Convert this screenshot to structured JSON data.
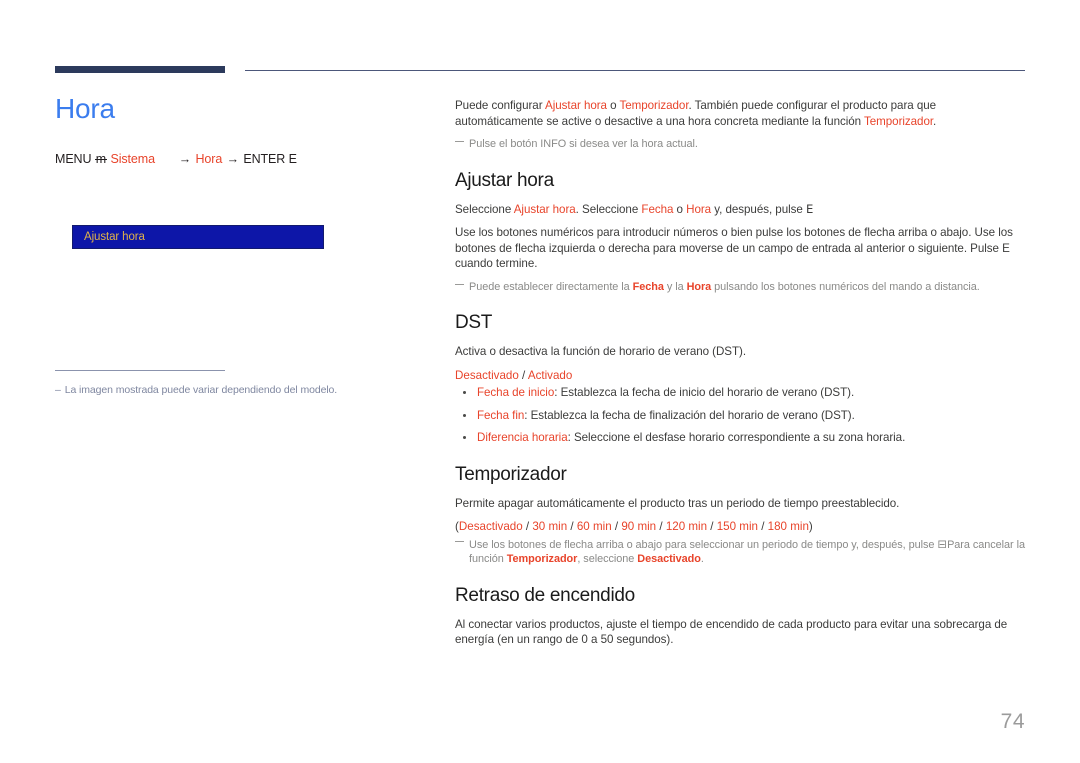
{
  "page": {
    "number": "74",
    "title": "Hora",
    "accent_color": "#e8442b",
    "title_color": "#3b7dee",
    "rule_color": "#2c3a5c"
  },
  "menu_path": {
    "menu_label": "MENU",
    "menu_glyph": "m",
    "item1": "Sistema",
    "arrow": "→",
    "item2": "Hora",
    "enter_label": "ENTER",
    "enter_glyph": "E"
  },
  "menu_image": {
    "label": "Ajustar hora",
    "fill_color": "#0d16a8",
    "border_color": "#121a6e",
    "text_color": "#e0b24a"
  },
  "left_note": {
    "dash": "–",
    "text": "La imagen mostrada puede variar dependiendo del modelo."
  },
  "intro": {
    "p1_a": "Puede configurar ",
    "p1_link1": "Ajustar hora",
    "p1_b": " o ",
    "p1_link2": "Temporizador",
    "p1_c": ". También puede configurar el producto para que automáticamente se active o desactive a una hora concreta mediante la función ",
    "p1_link3": "Temporizador",
    "p1_d": ".",
    "note1": "Pulse el botón INFO si desea ver la hora actual."
  },
  "ajustar_hora": {
    "heading": "Ajustar hora",
    "p1_a": "Seleccione ",
    "p1_link1": "Ajustar hora",
    "p1_b": ". Seleccione ",
    "p1_link2": "Fecha",
    "p1_c": " o ",
    "p1_link3": "Hora",
    "p1_d": " y, después, pulse ",
    "p1_glyph": "E",
    "p2": "Use los botones numéricos para introducir números o bien pulse los botones de flecha arriba o abajo. Use los botones de flecha izquierda o derecha para moverse de un campo de entrada al anterior o siguiente. Pulse E cuando termine.",
    "note_a": "Puede establecer directamente la ",
    "note_link1": "Fecha",
    "note_b": " y la ",
    "note_link2": "Hora",
    "note_c": " pulsando los botones numéricos del mando a distancia."
  },
  "dst": {
    "heading": "DST",
    "p1": "Activa o desactiva la función de horario de verano (DST).",
    "options_a": "Desactivado",
    "options_sep": " / ",
    "options_b": "Activado",
    "bullets": [
      {
        "term": "Fecha de inicio",
        "desc": ": Establezca la fecha de inicio del horario de verano (DST)."
      },
      {
        "term": "Fecha fin",
        "desc": ": Establezca la fecha de finalización del horario de verano (DST)."
      },
      {
        "term": "Diferencia horaria",
        "desc": ": Seleccione el desfase horario correspondiente a su zona horaria."
      }
    ]
  },
  "temporizador": {
    "heading": "Temporizador",
    "p1": "Permite apagar automáticamente el producto tras un periodo de tiempo preestablecido.",
    "options_open": "(",
    "options": [
      "Desactivado",
      "30 min",
      "60 min",
      "90 min",
      "120 min",
      "150 min",
      "180 min"
    ],
    "options_sep": " / ",
    "options_close": ")",
    "note_a": "Use los botones de flecha arriba o abajo para seleccionar un periodo de tiempo y, después, pulse ",
    "note_glyph": "⊟",
    "note_b": "Para cancelar la función ",
    "note_link1": "Temporizador",
    "note_c": ", seleccione ",
    "note_link2": "Desactivado",
    "note_d": "."
  },
  "retraso": {
    "heading": "Retraso de encendido",
    "p1": "Al conectar varios productos, ajuste el tiempo de encendido de cada producto para evitar una sobrecarga de energía (en un rango de 0 a 50 segundos)."
  }
}
